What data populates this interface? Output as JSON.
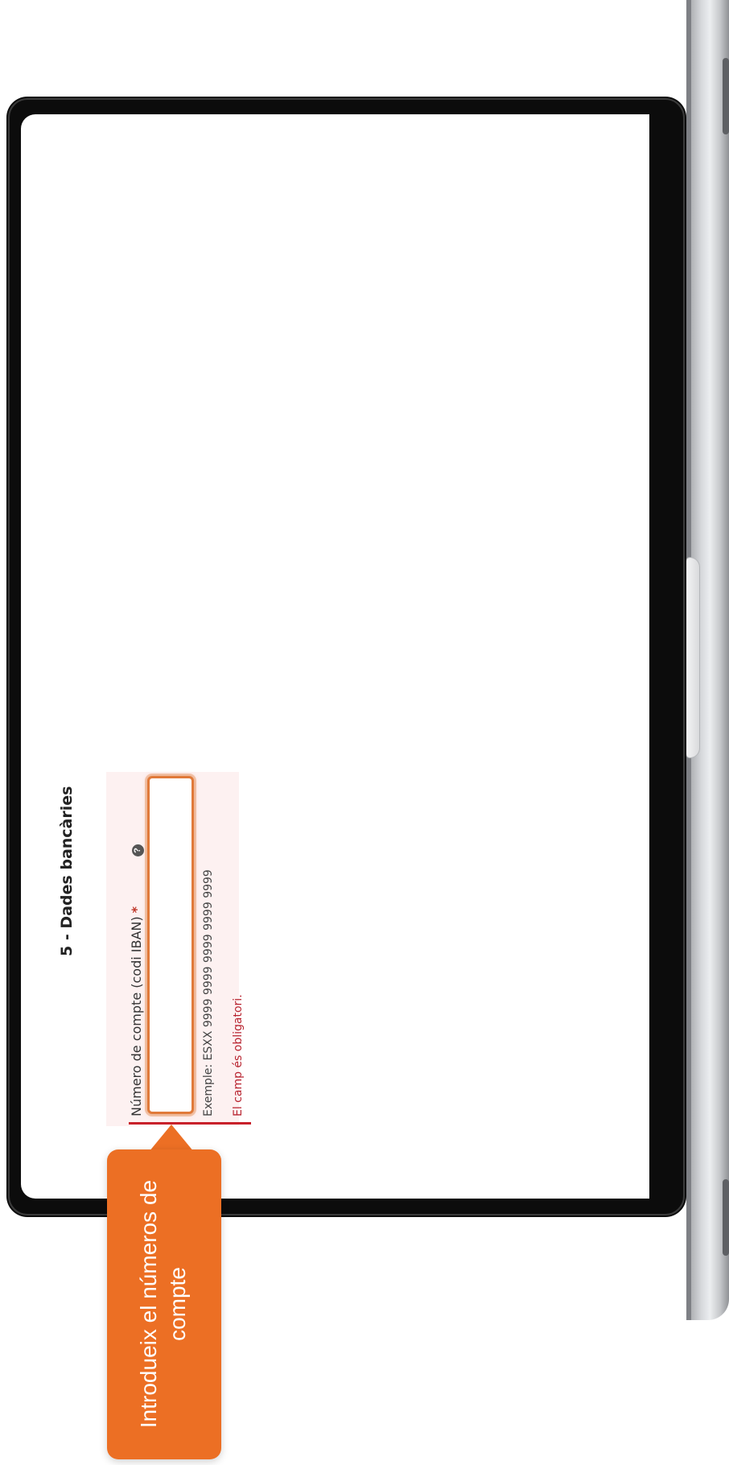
{
  "section": {
    "title": "5 - Dades bancàries"
  },
  "field": {
    "label": "Número de compte (codi IBAN)",
    "required_mark": "*",
    "help_icon": "question-icon",
    "value": "",
    "example": "Exemple: ESXX 9999 9999 9999 9999 9999",
    "error": "El camp és obligatori."
  },
  "callout": {
    "text": "Introdueix el números de compte"
  },
  "colors": {
    "accent": "#ec6f24",
    "error": "#b8232f",
    "field_error_bg": "#fdf1f1"
  }
}
